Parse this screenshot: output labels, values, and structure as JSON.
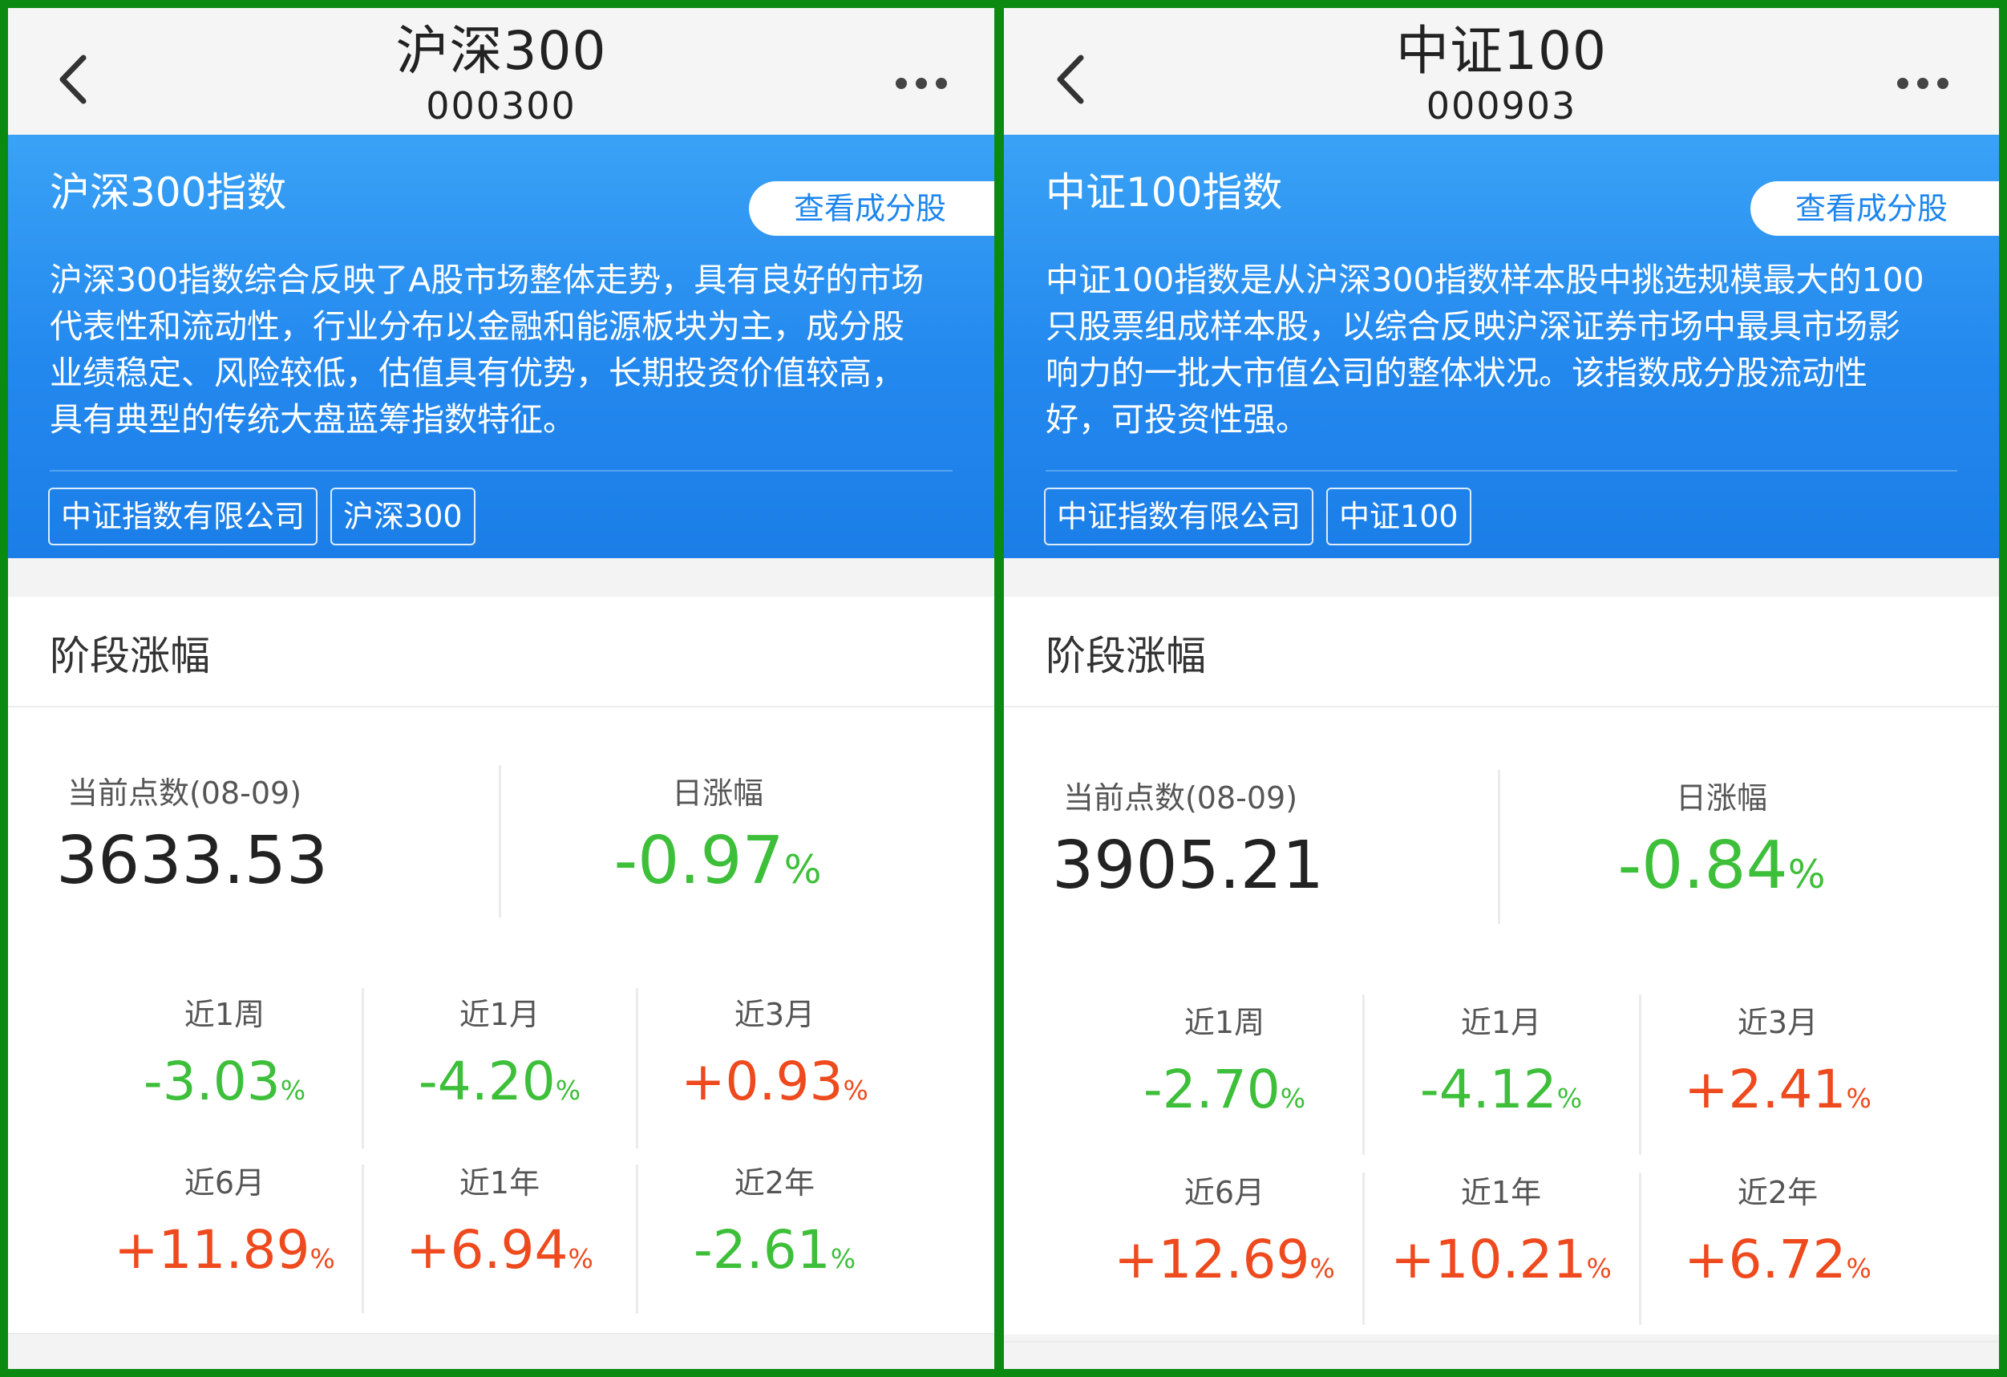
{
  "left": {
    "header": {
      "title": "沪深300",
      "code": "000300"
    },
    "card": {
      "name": "沪深300指数",
      "button": "查看成分股",
      "desc_lines": [
        "沪深300指数综合反映了A股市场整体走势，具有良好的市场",
        "代表性和流动性，行业分布以金融和能源板块为主，成分股",
        "业绩稳定、风险较低，估值具有优势，长期投资价值较高，",
        "具有典型的传统大盘蓝筹指数特征。"
      ],
      "tags": [
        "中证指数有限公司",
        "沪深300"
      ]
    },
    "section": {
      "title": "阶段涨幅",
      "current_label": "当前点数(08-09)",
      "current_value": "3633.53",
      "day_label": "日涨幅",
      "day_value": "-0.97",
      "periods": [
        {
          "label": "近1周",
          "value": "-3.03"
        },
        {
          "label": "近1月",
          "value": "-4.20"
        },
        {
          "label": "近3月",
          "value": "+0.93"
        },
        {
          "label": "近6月",
          "value": "+11.89"
        },
        {
          "label": "近1年",
          "value": "+6.94"
        },
        {
          "label": "近2年",
          "value": "-2.61"
        }
      ]
    }
  },
  "right": {
    "header": {
      "title": "中证100",
      "code": "000903"
    },
    "card": {
      "name": "中证100指数",
      "button": "查看成分股",
      "desc_lines": [
        "中证100指数是从沪深300指数样本股中挑选规模最大的100",
        "只股票组成样本股，以综合反映沪深证券市场中最具市场影",
        "响力的一批大市值公司的整体状况。该指数成分股流动性",
        "好，可投资性强。"
      ],
      "tags": [
        "中证指数有限公司",
        "中证100"
      ]
    },
    "section": {
      "title": "阶段涨幅",
      "current_label": "当前点数(08-09)",
      "current_value": "3905.21",
      "day_label": "日涨幅",
      "day_value": "-0.84",
      "periods": [
        {
          "label": "近1周",
          "value": "-2.70"
        },
        {
          "label": "近1月",
          "value": "-4.12"
        },
        {
          "label": "近3月",
          "value": "+2.41"
        },
        {
          "label": "近6月",
          "value": "+12.69"
        },
        {
          "label": "近1年",
          "value": "+10.21"
        },
        {
          "label": "近2年",
          "value": "+6.72"
        }
      ]
    }
  },
  "percent_sign": "%",
  "icons": {
    "back": "chevron-left-icon",
    "more": "more-dots-icon"
  },
  "colors": {
    "frame": "#0b8a12",
    "positive": "#ee4a1e",
    "negative": "#3dbf3a",
    "card_blue": "#2388ee"
  }
}
